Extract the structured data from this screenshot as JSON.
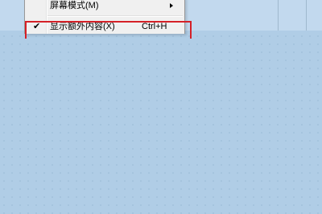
{
  "menu": {
    "items": [
      {
        "label": "屏幕模式(M)",
        "shortcut": "",
        "has_submenu": true,
        "checked": false
      },
      {
        "label": "显示额外内容(X)",
        "shortcut": "Ctrl+H",
        "has_submenu": false,
        "checked": true
      }
    ],
    "check_glyph": "✔"
  },
  "highlight_color": "#d52027",
  "canvas_color": "#b0cde6"
}
